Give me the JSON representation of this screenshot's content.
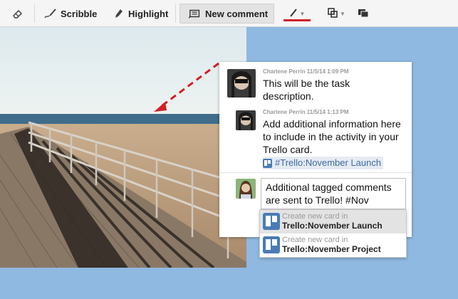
{
  "toolbar": {
    "eraser_icon": "eraser-icon",
    "scribble_label": "Scribble",
    "highlight_label": "Highlight",
    "new_comment_label": "New comment",
    "accent_color": "#d21f26"
  },
  "comments": [
    {
      "author_meta": "Charlene Perrin 11/5/14 1:09 PM",
      "text": "This will be the task description."
    },
    {
      "author_meta": "Charlene Perrin 11/5/14 1:13 PM",
      "text": "Add additional information here to include in the activity in your Trello card.",
      "tag": "#Trello:November Launch"
    }
  ],
  "reply": {
    "value": "Additional tagged comments are sent to Trello! #Nov"
  },
  "autocomplete": {
    "items": [
      {
        "hint": "Create new card in",
        "name": "Trello:November Launch",
        "selected": true
      },
      {
        "hint": "Create new card in",
        "name": "Trello:November Project",
        "selected": false
      }
    ]
  }
}
